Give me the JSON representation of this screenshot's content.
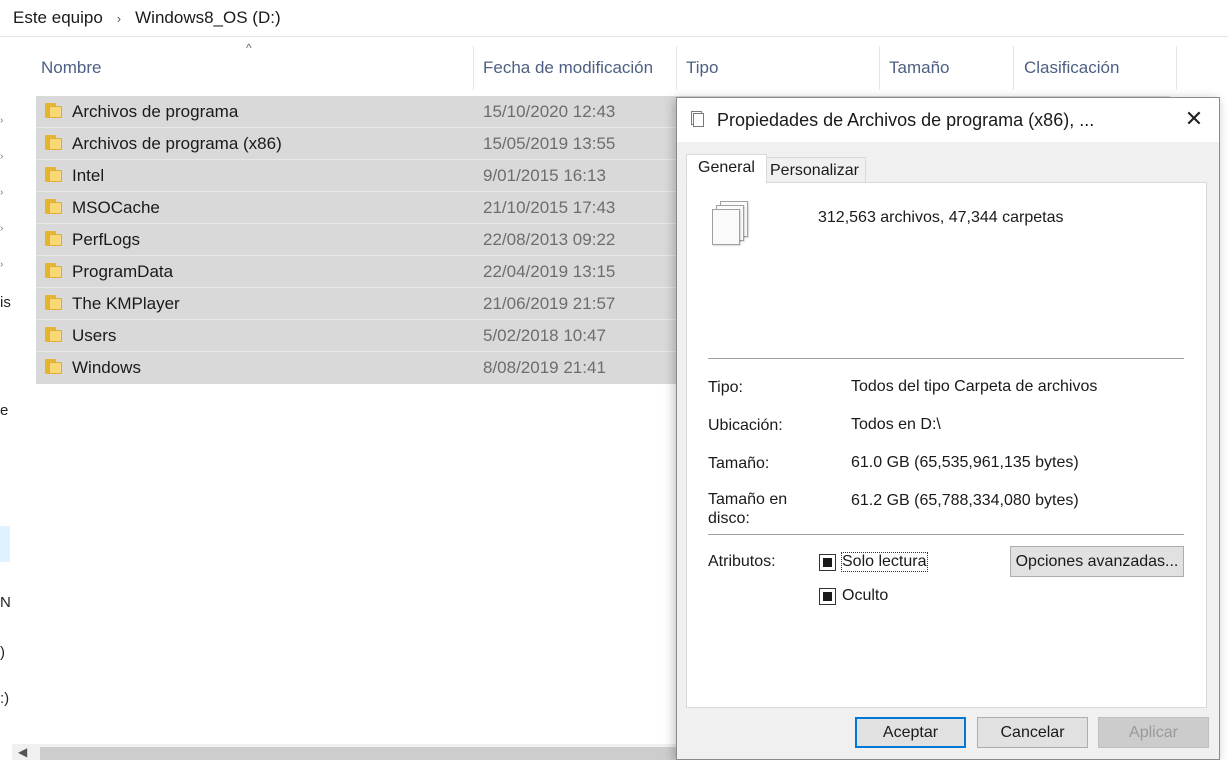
{
  "breadcrumb": {
    "items": [
      "Este equipo",
      "Windows8_OS (D:)"
    ],
    "separator": "›"
  },
  "nav_fragments": [
    "is",
    "e",
    "N",
    ")",
    ":)"
  ],
  "columns": {
    "name": "Nombre",
    "modified": "Fecha de modificación",
    "type": "Tipo",
    "size": "Tamaño",
    "rating": "Clasificación",
    "sort_indicator": "^"
  },
  "files": [
    {
      "name": "Archivos de programa",
      "modified": "15/10/2020 12:43"
    },
    {
      "name": "Archivos de programa (x86)",
      "modified": "15/05/2019 13:55"
    },
    {
      "name": "Intel",
      "modified": "9/01/2015 16:13"
    },
    {
      "name": "MSOCache",
      "modified": "21/10/2015 17:43"
    },
    {
      "name": "PerfLogs",
      "modified": "22/08/2013 09:22"
    },
    {
      "name": "ProgramData",
      "modified": "22/04/2019 13:15"
    },
    {
      "name": "The KMPlayer",
      "modified": "21/06/2019 21:57"
    },
    {
      "name": "Users",
      "modified": "5/02/2018 10:47"
    },
    {
      "name": "Windows",
      "modified": "8/08/2019 21:41"
    }
  ],
  "dialog": {
    "title": "Propiedades de Archivos de programa (x86), ...",
    "close_glyph": "✕",
    "tabs": [
      "General",
      "Personalizar"
    ],
    "summary": "312,563 archivos, 47,344 carpetas",
    "props": {
      "type_label": "Tipo:",
      "type_value": "Todos del tipo Carpeta de archivos",
      "location_label": "Ubicación:",
      "location_value": "Todos en D:\\",
      "size_label": "Tamaño:",
      "size_value": "61.0 GB (65,535,961,135 bytes)",
      "disk_size_label": "Tamaño en disco:",
      "disk_size_value": "61.2 GB (65,788,334,080 bytes)"
    },
    "attributes": {
      "label": "Atributos:",
      "readonly": "Solo lectura",
      "hidden": "Oculto",
      "advanced": "Opciones avanzadas..."
    },
    "buttons": {
      "ok": "Aceptar",
      "cancel": "Cancelar",
      "apply": "Aplicar"
    }
  },
  "colors": {
    "selection": "#d9d9d9",
    "header_text": "#4d6082",
    "accent": "#0078d7"
  }
}
